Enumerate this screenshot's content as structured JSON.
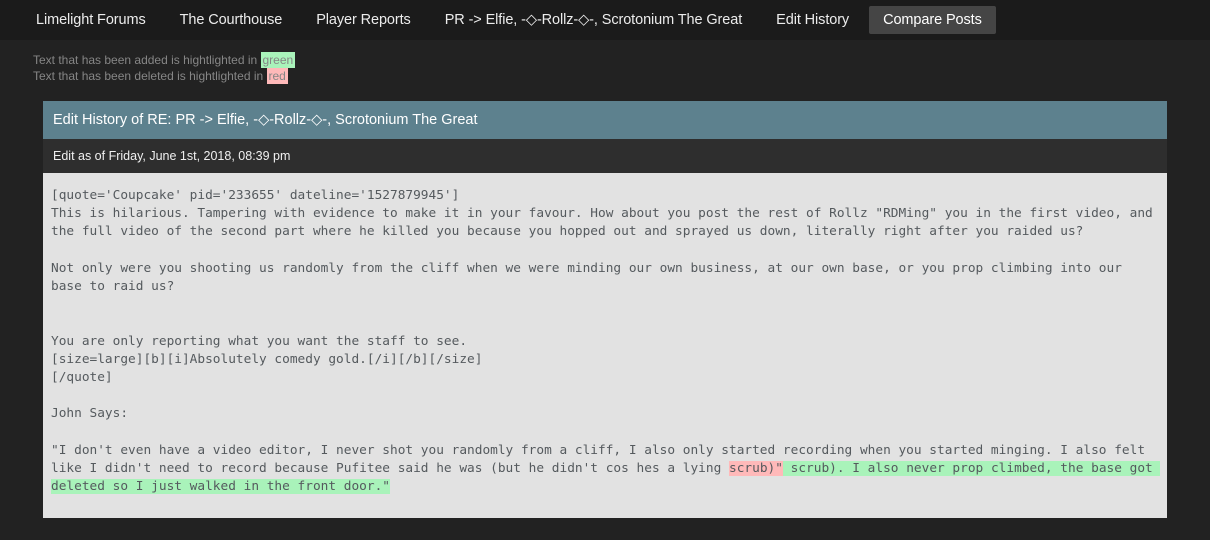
{
  "nav": {
    "items": [
      {
        "label": "Limelight Forums",
        "active": false
      },
      {
        "label": "The Courthouse",
        "active": false
      },
      {
        "label": "Player Reports",
        "active": false
      },
      {
        "label": "PR -> Elfie, -◇-Rollz-◇-, Scrotonium The Great",
        "active": false
      },
      {
        "label": "Edit History",
        "active": false
      },
      {
        "label": "Compare Posts",
        "active": true
      }
    ]
  },
  "legend": {
    "added_prefix": "Text that has been added is hightlighted in ",
    "added_word": "green",
    "deleted_prefix": "Text that has been deleted is hightlighted in ",
    "deleted_word": "red"
  },
  "panel": {
    "header": "Edit History of RE: PR -> Elfie, -◇-Rollz-◇-, Scrotonium The Great",
    "subheader": "Edit as of Friday, June 1st, 2018, 08:39 pm"
  },
  "diff": {
    "segments": [
      {
        "type": "plain",
        "text": "[quote='Coupcake' pid='233655' dateline='1527879945']\nThis is hilarious. Tampering with evidence to make it in your favour. How about you post the rest of Rollz \"RDMing\" you in the first video, and the full video of the second part where he killed you because you hopped out and sprayed us down, literally right after you raided us?\n\nNot only were you shooting us randomly from the cliff when we were minding our own business, at our own base, or you prop climbing into our base to raid us?\n\n\nYou are only reporting what you want the staff to see.\n[size=large][b][i]Absolutely comedy gold.[/i][/b][/size]\n[/quote]\n\nJohn Says:\n\n\"I don't even have a video editor, I never shot you randomly from a cliff, I also only started recording when you started minging. I also felt like I didn't need to record because Pufitee said he was (but he didn't cos hes a lying "
      },
      {
        "type": "deleted",
        "text": "scrub)\""
      },
      {
        "type": "added",
        "text": " scrub). I also never prop climbed, the base got deleted so I just walked in the front door.\""
      }
    ]
  },
  "colors": {
    "page_background": "#222222",
    "nav_background": "#1b1b1b",
    "nav_active_background": "#454545",
    "panel_header": "#5d818e",
    "panel_subheader": "#2e2e2e",
    "panel_body": "#e2e2e2",
    "highlight_added": "#a9f3ba",
    "highlight_deleted": "#ffb9b9",
    "body_text": "#555a5e",
    "legend_text": "#868686"
  }
}
